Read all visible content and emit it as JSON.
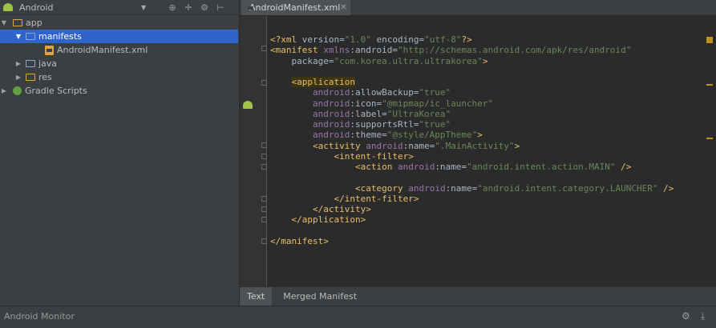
{
  "project_panel": {
    "view_label": "Android",
    "tree": [
      {
        "label": "app",
        "kind": "module",
        "expanded": true
      },
      {
        "label": "manifests",
        "kind": "folder",
        "expanded": true,
        "selected": true
      },
      {
        "label": "AndroidManifest.xml",
        "kind": "xml-file"
      },
      {
        "label": "java",
        "kind": "folder",
        "expanded": false
      },
      {
        "label": "res",
        "kind": "res-folder",
        "expanded": false
      },
      {
        "label": "Gradle Scripts",
        "kind": "gradle",
        "expanded": false
      }
    ]
  },
  "editor": {
    "tab_label": "AndroidManifest.xml",
    "bottom_tabs": [
      "Text",
      "Merged Manifest"
    ],
    "active_bottom_tab": "Text",
    "code_lines": [
      "<?xml version=\"1.0\" encoding=\"utf-8\"?>",
      "<manifest xmlns:android=\"http://schemas.android.com/apk/res/android\"",
      "    package=\"com.korea.ultra.ultrakorea\">",
      "",
      "    <application",
      "        android:allowBackup=\"true\"",
      "        android:icon=\"@mipmap/ic_launcher\"",
      "        android:label=\"UltraKorea\"",
      "        android:supportsRtl=\"true\"",
      "        android:theme=\"@style/AppTheme\">",
      "        <activity android:name=\".MainActivity\">",
      "            <intent-filter>",
      "                <action android:name=\"android.intent.action.MAIN\" />",
      "",
      "                <category android:name=\"android.intent.category.LAUNCHER\" />",
      "            </intent-filter>",
      "        </activity>",
      "    </application>",
      "",
      "</manifest>"
    ]
  },
  "status_bar": {
    "label": "Android Monitor"
  },
  "colors": {
    "selection": "#2f65ca",
    "tag": "#e8bf6a",
    "string": "#6a8759",
    "namespace": "#9876aa",
    "warning": "#be9117"
  },
  "icons": [
    "android-icon",
    "collapse-all-icon",
    "scroll-from-source-icon",
    "gear-icon",
    "hide-icon",
    "close-icon",
    "download-icon"
  ]
}
